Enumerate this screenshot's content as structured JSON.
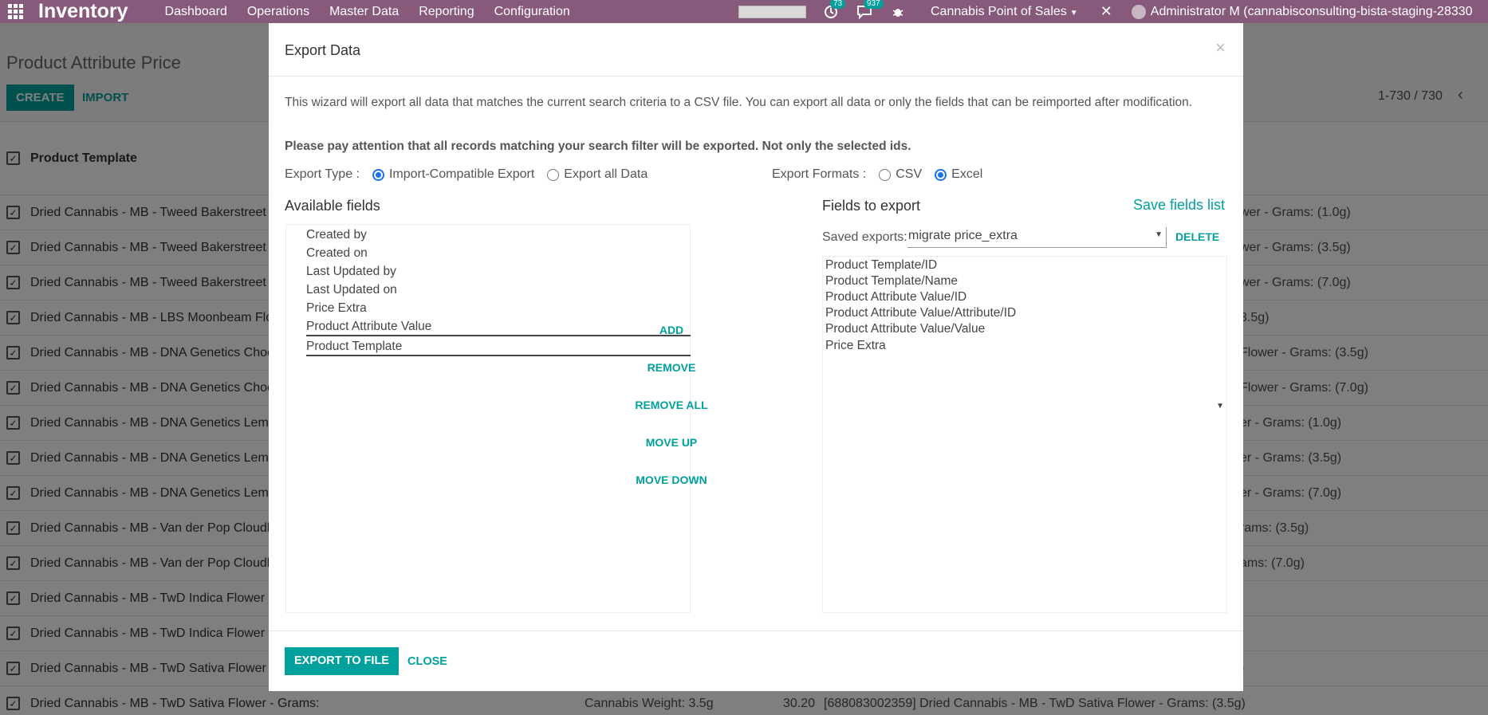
{
  "navbar": {
    "brand": "Inventory",
    "menu": [
      "Dashboard",
      "Operations",
      "Master Data",
      "Reporting",
      "Configuration"
    ],
    "activity_badge": "73",
    "messages_badge": "937",
    "company": "Cannabis Point of Sales",
    "user": "Administrator M (cannabisconsulting-bista-staging-28330"
  },
  "page": {
    "title": "Product Attribute Price",
    "create_label": "CREATE",
    "import_label": "IMPORT",
    "pager": "1-730 / 730",
    "column_header": "Product Template"
  },
  "rows": [
    {
      "name": "Dried Cannabis - MB - Tweed Bakerstreet",
      "right": "wer - Grams: (1.0g)"
    },
    {
      "name": "Dried Cannabis - MB - Tweed Bakerstreet",
      "right": "wer - Grams: (3.5g)"
    },
    {
      "name": "Dried Cannabis - MB - Tweed Bakerstreet",
      "right": "wer - Grams: (7.0g)"
    },
    {
      "name": "Dried Cannabis - MB - LBS Moonbeam Flo",
      "right": "3.5g)"
    },
    {
      "name": "Dried Cannabis - MB - DNA Genetics Choc",
      "right": "Flower - Grams: (3.5g)"
    },
    {
      "name": "Dried Cannabis - MB - DNA Genetics Choc",
      "right": "Flower - Grams: (7.0g)"
    },
    {
      "name": "Dried Cannabis - MB - DNA Genetics Lemo",
      "right": "er - Grams: (1.0g)"
    },
    {
      "name": "Dried Cannabis - MB - DNA Genetics Lemo",
      "right": "er - Grams: (3.5g)"
    },
    {
      "name": "Dried Cannabis - MB - DNA Genetics Lemo",
      "right": "er - Grams: (7.0g)"
    },
    {
      "name": "Dried Cannabis - MB - Van der Pop Cloudb",
      "right": "rams: (3.5g)"
    },
    {
      "name": "Dried Cannabis - MB - Van der Pop Cloudb",
      "right": "ams: (7.0g)"
    },
    {
      "name": "Dried Cannabis - MB - TwD Indica Flower -",
      "right": ""
    },
    {
      "name": "Dried Cannabis - MB - TwD Indica Flower -",
      "right": ""
    },
    {
      "name": "Dried Cannabis - MB - TwD Sativa Flower -",
      "right": ")"
    }
  ],
  "last_row": {
    "name": "Dried Cannabis - MB - TwD Sativa Flower - Grams:",
    "weight": "Cannabis Weight: 3.5g",
    "price": "30.20",
    "full": "[688083002359] Dried Cannabis - MB - TwD Sativa Flower - Grams: (3.5g)"
  },
  "modal": {
    "title": "Export Data",
    "close_symbol": "×",
    "intro": "This wizard will export all data that matches the current search criteria to a CSV file. You can export all data or only the fields that can be reimported after modification.",
    "warning": "Please pay attention that all records matching your search filter will be exported. Not only the selected ids.",
    "export_type_label": "Export Type :",
    "type_import_compatible": "Import-Compatible Export",
    "type_all_data": "Export all Data",
    "export_formats_label": "Export Formats :",
    "format_csv": "CSV",
    "format_excel": "Excel",
    "available_title": "Available fields",
    "available_fields": [
      "Created by",
      "Created on",
      "Last Updated by",
      "Last Updated on",
      "Price Extra",
      "Product Attribute Value",
      "Product Template"
    ],
    "buttons": {
      "add": "ADD",
      "remove": "REMOVE",
      "remove_all": "REMOVE ALL",
      "move_up": "MOVE UP",
      "move_down": "MOVE DOWN"
    },
    "export_title": "Fields to export",
    "save_fields_list": "Save fields list",
    "saved_exports_label": "Saved exports:",
    "saved_exports_value": "migrate price_extra",
    "delete_label": "DELETE",
    "export_fields": [
      "Product Template/ID",
      "Product Template/Name",
      "Product Attribute Value/ID",
      "Product Attribute Value/Attribute/ID",
      "Product Attribute Value/Value",
      "Price Extra"
    ],
    "export_to_file": "EXPORT TO FILE",
    "close_label": "CLOSE"
  },
  "colors": {
    "brand": "#875a7b",
    "accent": "#00a09d",
    "radio": "#1a73e8"
  }
}
